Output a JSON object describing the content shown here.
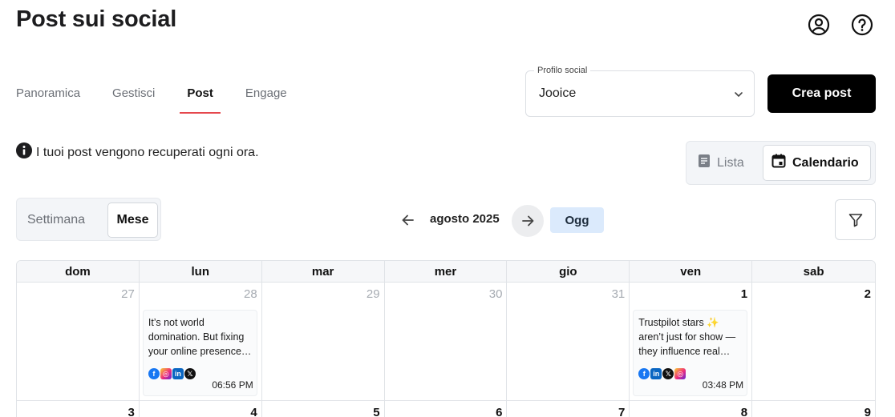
{
  "header": {
    "title": "Post sui social"
  },
  "tabs": [
    {
      "label": "Panoramica"
    },
    {
      "label": "Gestisci"
    },
    {
      "label": "Post"
    },
    {
      "label": "Engage"
    }
  ],
  "profile": {
    "label": "Profilo social",
    "value": "Jooice"
  },
  "create_button": {
    "label": "Crea post"
  },
  "info": {
    "text": "I tuoi post vengono recuperati ogni ora."
  },
  "view_toggle": {
    "list": "Lista",
    "calendar": "Calendario"
  },
  "range_toggle": {
    "week": "Settimana",
    "month": "Mese"
  },
  "navigation": {
    "month_label": "agosto 2025",
    "today": "Ogg"
  },
  "calendar": {
    "weekdays": [
      "dom",
      "lun",
      "mar",
      "mer",
      "gio",
      "ven",
      "sab"
    ],
    "week1": [
      "27",
      "28",
      "29",
      "30",
      "31",
      "1",
      "2"
    ],
    "week2": [
      "3",
      "4",
      "5",
      "6",
      "7",
      "8",
      "9"
    ],
    "posts": [
      {
        "text": "It’s not world domination. But fixing your online presence…",
        "time": "06:56 PM",
        "icons": [
          "facebook-icon",
          "instagram-icon",
          "linkedin-icon",
          "x-icon"
        ]
      },
      {
        "text": "Trustpilot stars ✨ aren’t just for show — they influence real…",
        "time": "03:48 PM",
        "icons": [
          "facebook-icon",
          "linkedin-icon",
          "x-icon",
          "instagram-icon"
        ]
      }
    ]
  },
  "colors": {
    "accent": "#e5484d",
    "today_bg": "#dbeafc",
    "primary_button": "#000000"
  }
}
